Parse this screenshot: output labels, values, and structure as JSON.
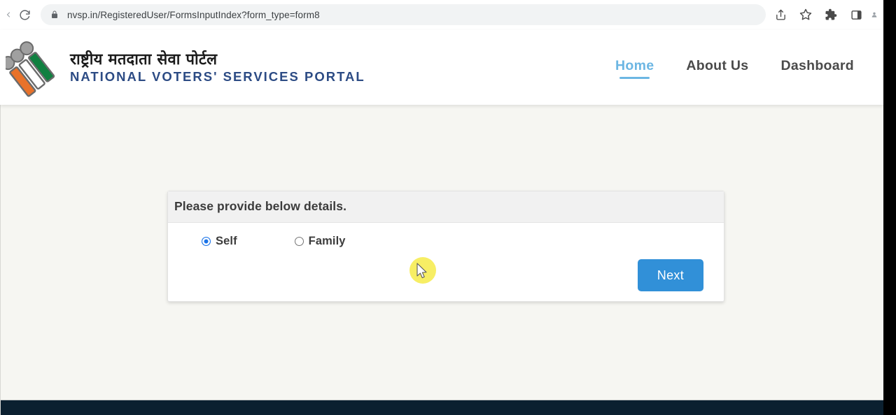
{
  "browser": {
    "url": "nvsp.in/RegisteredUser/FormsInputIndex?form_type=form8",
    "reload_icon": "reload-icon",
    "lock_icon": "lock-icon",
    "share_icon": "share-icon",
    "bookmark_icon": "star-icon",
    "extensions_icon": "puzzle-piece-icon",
    "side_panel_icon": "side-panel-icon"
  },
  "site_header": {
    "logo": {
      "icon": "eci-voter-logo",
      "bar_colors": [
        "#e8722a",
        "#ffffff",
        "#108040"
      ],
      "circle_color": "#9a9a9a"
    },
    "brand_hindi": "राष्ट्रीय मतदाता सेवा पोर्टल",
    "brand_english": "NATIONAL VOTERS' SERVICES PORTAL",
    "nav": [
      {
        "label": "Home",
        "active": true
      },
      {
        "label": "About Us",
        "active": false
      },
      {
        "label": "Dashboard",
        "active": false
      }
    ]
  },
  "form_card": {
    "header_title": "Please provide below details.",
    "options": [
      {
        "label": "Self",
        "selected": true
      },
      {
        "label": "Family",
        "selected": false
      }
    ],
    "next_label": "Next"
  },
  "colors": {
    "accent_blue": "#3190d8",
    "nav_active": "#6cb6e3",
    "radio_selected": "#1a73e8",
    "page_background": "#f6f6f2",
    "card_header": "#f1f1f1",
    "cursor_highlight": "#f6ec4e",
    "bottom_bar": "#0b2030"
  }
}
